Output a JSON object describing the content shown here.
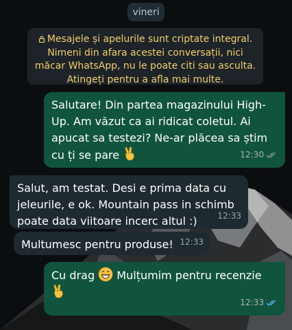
{
  "chat": {
    "day_chip": "vineri",
    "encryption_notice": "Mesajele și apelurile sunt criptate integral. Nimeni din afara acestei conversații, nici măcar WhatsApp, nu le poate citi sau asculta. Atingeți pentru a afla mai multe.",
    "messages": [
      {
        "direction": "outgoing",
        "text": "Salutare! Din partea magazinului High-Up. Am văzut ca ai ridicat coletul. Ai apucat sa testezi? Ne-ar plăcea sa știm cu ți se pare",
        "emoji_after": "victory-hand",
        "time": "12:30",
        "status": "delivered",
        "status_color": "#8b9a94"
      },
      {
        "direction": "incoming",
        "text": "Salut, am testat. Desi e prima data cu jeleurile, e ok. Mountain pass in schimb poate data viitoare incerc altul :)",
        "time": "12:33"
      },
      {
        "direction": "incoming",
        "text": "Multumesc pentru produse!",
        "time": "12:33"
      },
      {
        "direction": "outgoing",
        "text_before": "Cu drag",
        "emoji_inline": "grinning-face",
        "text_after": "Mulțumim pentru recenzie",
        "emoji_after": "victory-hand",
        "time": "12:33",
        "status": "read",
        "status_color": "#53bdeb"
      }
    ]
  },
  "colors": {
    "background": "#0b0e10",
    "outgoing_bubble": "#11543d",
    "incoming_bubble": "#1f2a30",
    "encryption_text": "#f2cf6b",
    "read_tick": "#53bdeb"
  }
}
